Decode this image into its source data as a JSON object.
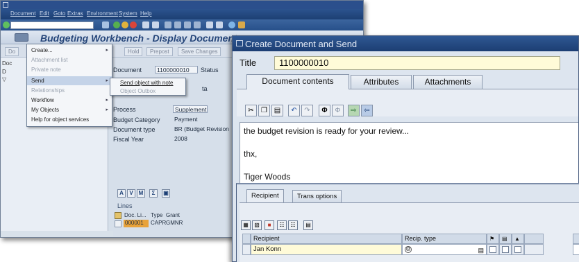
{
  "sap": {
    "menu": [
      "Document",
      "Edit",
      "Goto",
      "Extras",
      "Environment",
      "System",
      "Help"
    ],
    "app_title": "Budgeting Workbench - Display Document",
    "toolbar_buttons": [
      "Hold",
      "Prepost",
      "Save Changes"
    ],
    "document_label": "Document",
    "document_number": "1100000010",
    "status_label": "Status",
    "tab_fragment": "ta",
    "fields": [
      {
        "label": "Process",
        "value": "Supplement"
      },
      {
        "label": "Budget Category",
        "value": "Payment"
      },
      {
        "label": "Document type",
        "value": "BR (Budget Revision"
      },
      {
        "label": "Fiscal Year",
        "value": "2008"
      }
    ],
    "tree_fragments": [
      "Do",
      "Doc",
      "D",
      "▽"
    ],
    "lines": {
      "title": "Lines",
      "columns": [
        "Doc. Li...",
        "Type",
        "Grant"
      ],
      "row": [
        "000001",
        "CAPR",
        "GMNR"
      ]
    }
  },
  "context_menu": {
    "items": [
      {
        "label": "Create...",
        "disabled": false,
        "submenu": true
      },
      {
        "label": "Attachment list",
        "disabled": true,
        "submenu": false
      },
      {
        "label": "Private note",
        "disabled": true,
        "submenu": false
      },
      {
        "label": "Send",
        "disabled": false,
        "submenu": true,
        "selected": true
      },
      {
        "label": "Relationships",
        "disabled": true,
        "submenu": false
      },
      {
        "label": "Workflow",
        "disabled": false,
        "submenu": true
      },
      {
        "label": "My Objects",
        "disabled": false,
        "submenu": true
      },
      {
        "label": "Help for object services",
        "disabled": false,
        "submenu": false
      }
    ],
    "submenu": [
      {
        "label": "Send object with note",
        "disabled": false
      },
      {
        "label": "Object Outbox",
        "disabled": true
      }
    ]
  },
  "dialog": {
    "title": "Create Document and Send",
    "title_label": "Title",
    "title_value": "1100000010",
    "tabs": [
      "Document contents",
      "Attributes",
      "Attachments"
    ],
    "body_lines": [
      "the budget revision is ready for your review...",
      "thx,",
      "Tiger Woods"
    ],
    "recipient_tabs": [
      "Recipient",
      "Trans options"
    ],
    "columns": [
      "Recipient",
      "Recip. type"
    ],
    "recipient_row": {
      "name": "Jan Konn"
    }
  },
  "colors": {
    "title_blue": "#2b4f8c",
    "input_yellow": "#fffbd8",
    "row_orange": "#e8a23a"
  }
}
